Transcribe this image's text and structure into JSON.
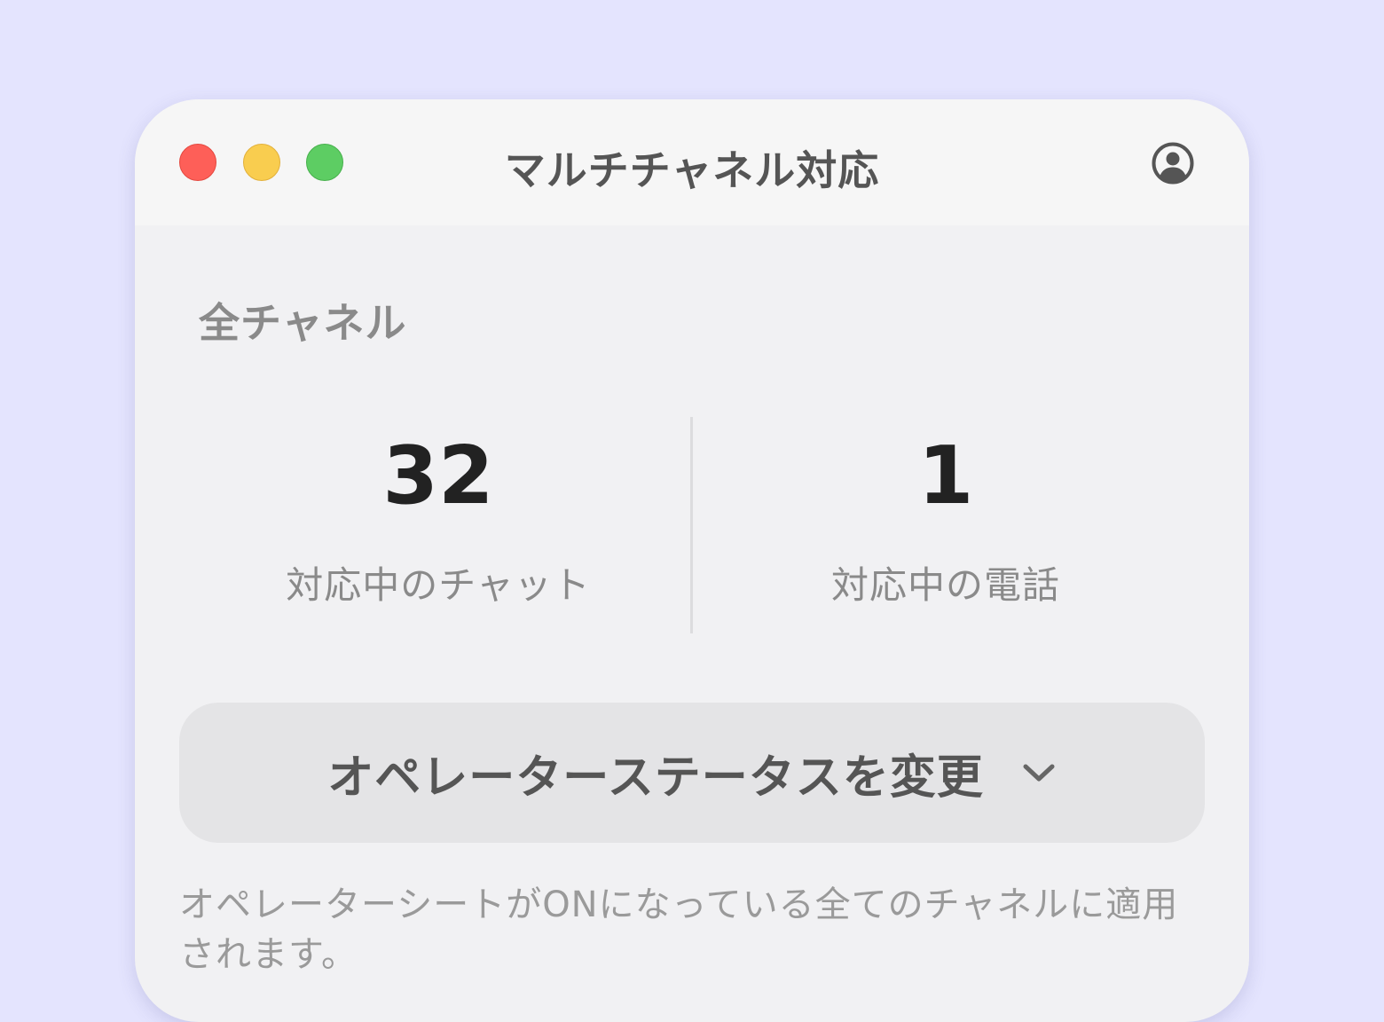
{
  "window": {
    "title": "マルチチャネル対応",
    "traffic_lights": {
      "close": "#fe5f58",
      "minimize": "#f9cd4f",
      "zoom": "#5dcd63"
    },
    "account_icon": "account-circle-icon"
  },
  "section": {
    "label": "全チャネル"
  },
  "stats": {
    "chat": {
      "value": "32",
      "label": "対応中のチャット"
    },
    "phone": {
      "value": "1",
      "label": "対応中の電話"
    }
  },
  "status_button": {
    "label": "オペレーターステータスを変更",
    "icon": "chevron-down-icon"
  },
  "note": "オペレーターシートがONになっている全てのチャネルに適用されます。",
  "colors": {
    "background": "#e4e4fe",
    "window": "#f1f1f3",
    "titlebar": "#f6f6f6",
    "button": "#e4e4e6"
  }
}
